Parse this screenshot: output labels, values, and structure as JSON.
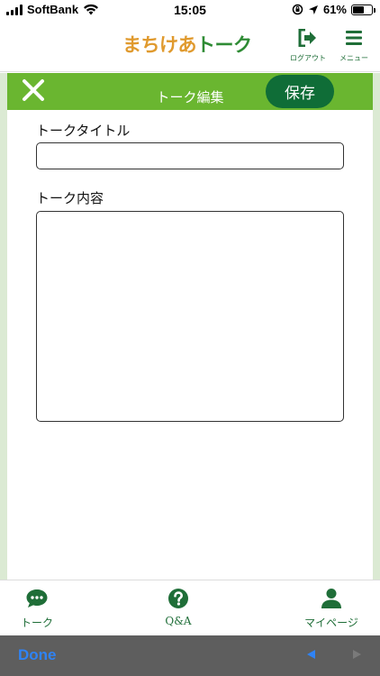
{
  "status_bar": {
    "carrier": "SoftBank",
    "time": "15:05",
    "battery_percent": "61%",
    "battery_level": 0.61,
    "icons": [
      "signal-icon",
      "wifi-icon",
      "lock-rotation-icon",
      "location-icon",
      "battery-icon"
    ]
  },
  "header": {
    "logo_part1": "まちけあ",
    "logo_part2": "トーク",
    "logout_label": "ログアウト",
    "menu_label": "メニュー",
    "logout_icon": "logout-icon",
    "menu_icon": "hamburger-menu-icon"
  },
  "editor": {
    "title": "トーク編集",
    "save_label": "保存",
    "close_icon": "close-icon"
  },
  "form": {
    "title_label": "トークタイトル",
    "title_value": "",
    "content_label": "トーク内容",
    "content_value": ""
  },
  "bottom_nav": {
    "items": [
      {
        "label": "トーク",
        "icon": "chat-bubble-icon"
      },
      {
        "label": "Q&A",
        "icon": "question-circle-icon"
      },
      {
        "label": "マイページ",
        "icon": "user-icon"
      }
    ]
  },
  "keyboard_bar": {
    "done_label": "Done"
  },
  "colors": {
    "brand_green": "#6ab630",
    "dark_green": "#0f6d37",
    "logo_orange": "#e09a2e",
    "logo_green": "#2e8b34",
    "frame_green": "#dbead3",
    "ios_blue": "#2f83f5"
  }
}
